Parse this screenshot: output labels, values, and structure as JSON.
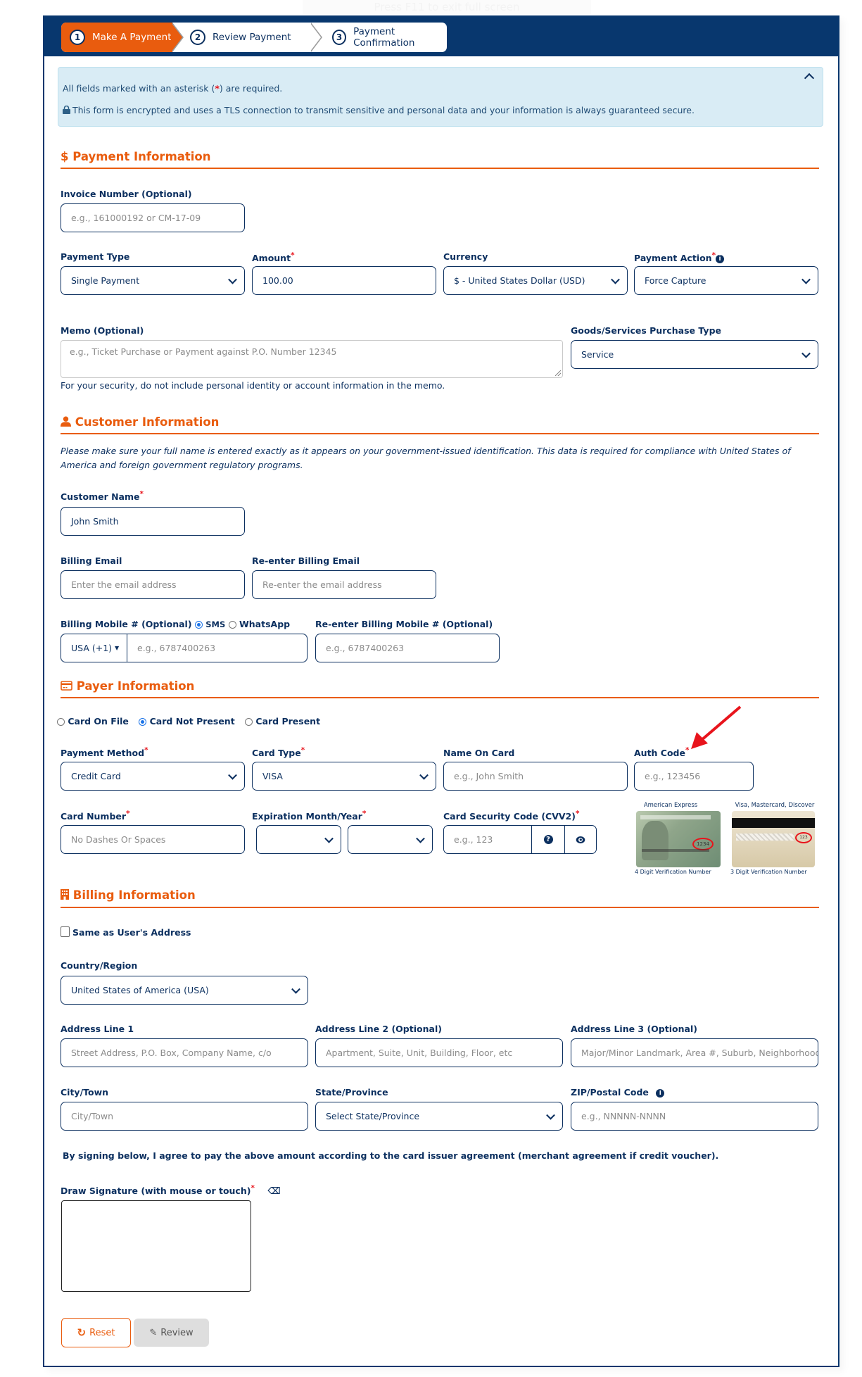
{
  "overlay_hint": "Press  F11  to exit full screen",
  "steps": [
    {
      "num": "1",
      "label": "Make A Payment",
      "active": true
    },
    {
      "num": "2",
      "label": "Review Payment",
      "active": false
    },
    {
      "num": "3",
      "label": "Payment Confirmation",
      "active": false
    }
  ],
  "notice": {
    "required_prefix": "All fields marked with an asterisk (",
    "required_star": "*",
    "required_suffix": ") are required.",
    "secure_text": "This form is encrypted and uses a TLS connection to transmit sensitive and personal data and your information is always guaranteed secure."
  },
  "payment_info": {
    "title": "Payment Information",
    "icon": "dollar-icon",
    "invoice": {
      "label": "Invoice Number (Optional)",
      "placeholder": "e.g., 161000192 or CM-17-09",
      "value": ""
    },
    "payment_type": {
      "label": "Payment Type",
      "value": "Single Payment"
    },
    "amount": {
      "label": "Amount",
      "value": "100.00",
      "required": true
    },
    "currency": {
      "label": "Currency",
      "value": "$ - United States Dollar (USD)"
    },
    "payment_action": {
      "label": "Payment Action",
      "value": "Force Capture",
      "required": true
    },
    "memo": {
      "label": "Memo (Optional)",
      "placeholder": "e.g., Ticket Purchase or Payment against P.O. Number 12345",
      "note": "For your security, do not include personal identity or account information in the memo."
    },
    "purchase_type": {
      "label": "Goods/Services Purchase Type",
      "value": "Service"
    }
  },
  "customer_info": {
    "title": "Customer Information",
    "icon": "user-icon",
    "note": "Please make sure your full name is entered exactly as it appears on your government-issued identification. This data is required for compliance with United States of America and foreign government regulatory programs.",
    "name": {
      "label": "Customer Name",
      "value": "John Smith",
      "required": true
    },
    "email": {
      "label": "Billing Email",
      "placeholder": "Enter the email address"
    },
    "email_confirm": {
      "label": "Re-enter Billing Email",
      "placeholder": "Re-enter the email address"
    },
    "mobile": {
      "label": "Billing Mobile # (Optional)",
      "sms_label": "SMS",
      "whatsapp_label": "WhatsApp",
      "selected": "SMS",
      "country_code": "USA (+1)",
      "placeholder": "e.g., 6787400263"
    },
    "mobile_confirm": {
      "label": "Re-enter Billing Mobile # (Optional)",
      "placeholder": "e.g., 6787400263"
    }
  },
  "payer_info": {
    "title": "Payer Information",
    "icon": "credit-card-icon",
    "card_modes": [
      {
        "label": "Card On File",
        "selected": false
      },
      {
        "label": "Card Not Present",
        "selected": true
      },
      {
        "label": "Card Present",
        "selected": false
      }
    ],
    "payment_method": {
      "label": "Payment Method",
      "value": "Credit Card",
      "required": true
    },
    "card_type": {
      "label": "Card Type",
      "value": "VISA",
      "required": true
    },
    "name_on_card": {
      "label": "Name On Card",
      "placeholder": "e.g., John Smith"
    },
    "auth_code": {
      "label": "Auth Code",
      "placeholder": "e.g., 123456",
      "required": true
    },
    "card_number": {
      "label": "Card Number",
      "placeholder": "No Dashes Or Spaces",
      "required": true
    },
    "expiration": {
      "label": "Expiration Month/Year",
      "month": "",
      "year": "",
      "required": true
    },
    "cvv": {
      "label": "Card Security Code (CVV2)",
      "placeholder": "e.g., 123",
      "required": true
    },
    "cvv_help": {
      "amex_title": "American Express",
      "amex_caption": "4 Digit Verification Number",
      "amex_sample": "1234",
      "visa_title": "Visa, Mastercard, Discover",
      "visa_caption": "3 Digit Verification Number",
      "visa_sample": "123"
    }
  },
  "billing_info": {
    "title": "Billing Information",
    "icon": "building-icon",
    "same_as_user": {
      "label": "Same as User's Address",
      "checked": false
    },
    "country": {
      "label": "Country/Region",
      "value": "United States of America (USA)"
    },
    "address1": {
      "label": "Address Line 1",
      "placeholder": "Street Address, P.O. Box, Company Name, c/o"
    },
    "address2": {
      "label": "Address Line 2 (Optional)",
      "placeholder": "Apartment, Suite, Unit, Building, Floor, etc"
    },
    "address3": {
      "label": "Address Line 3 (Optional)",
      "placeholder": "Major/Minor Landmark, Area #, Suburb, Neighborhood"
    },
    "city": {
      "label": "City/Town",
      "placeholder": "City/Town"
    },
    "state": {
      "label": "State/Province",
      "value": "Select State/Province"
    },
    "zip": {
      "label": "ZIP/Postal Code",
      "placeholder": "e.g., NNNNN-NNNN"
    },
    "agreement": "By signing below, I agree to pay the above amount according to the card issuer agreement (merchant agreement if credit voucher).",
    "signature": {
      "label": "Draw Signature (with mouse or touch)",
      "required": true
    }
  },
  "actions": {
    "reset_label": "Reset",
    "review_label": "Review"
  },
  "colors": {
    "navy": "#08376e",
    "orange": "#e95c0e",
    "info_bg": "#d9ecf5",
    "required": "#e8141c"
  }
}
